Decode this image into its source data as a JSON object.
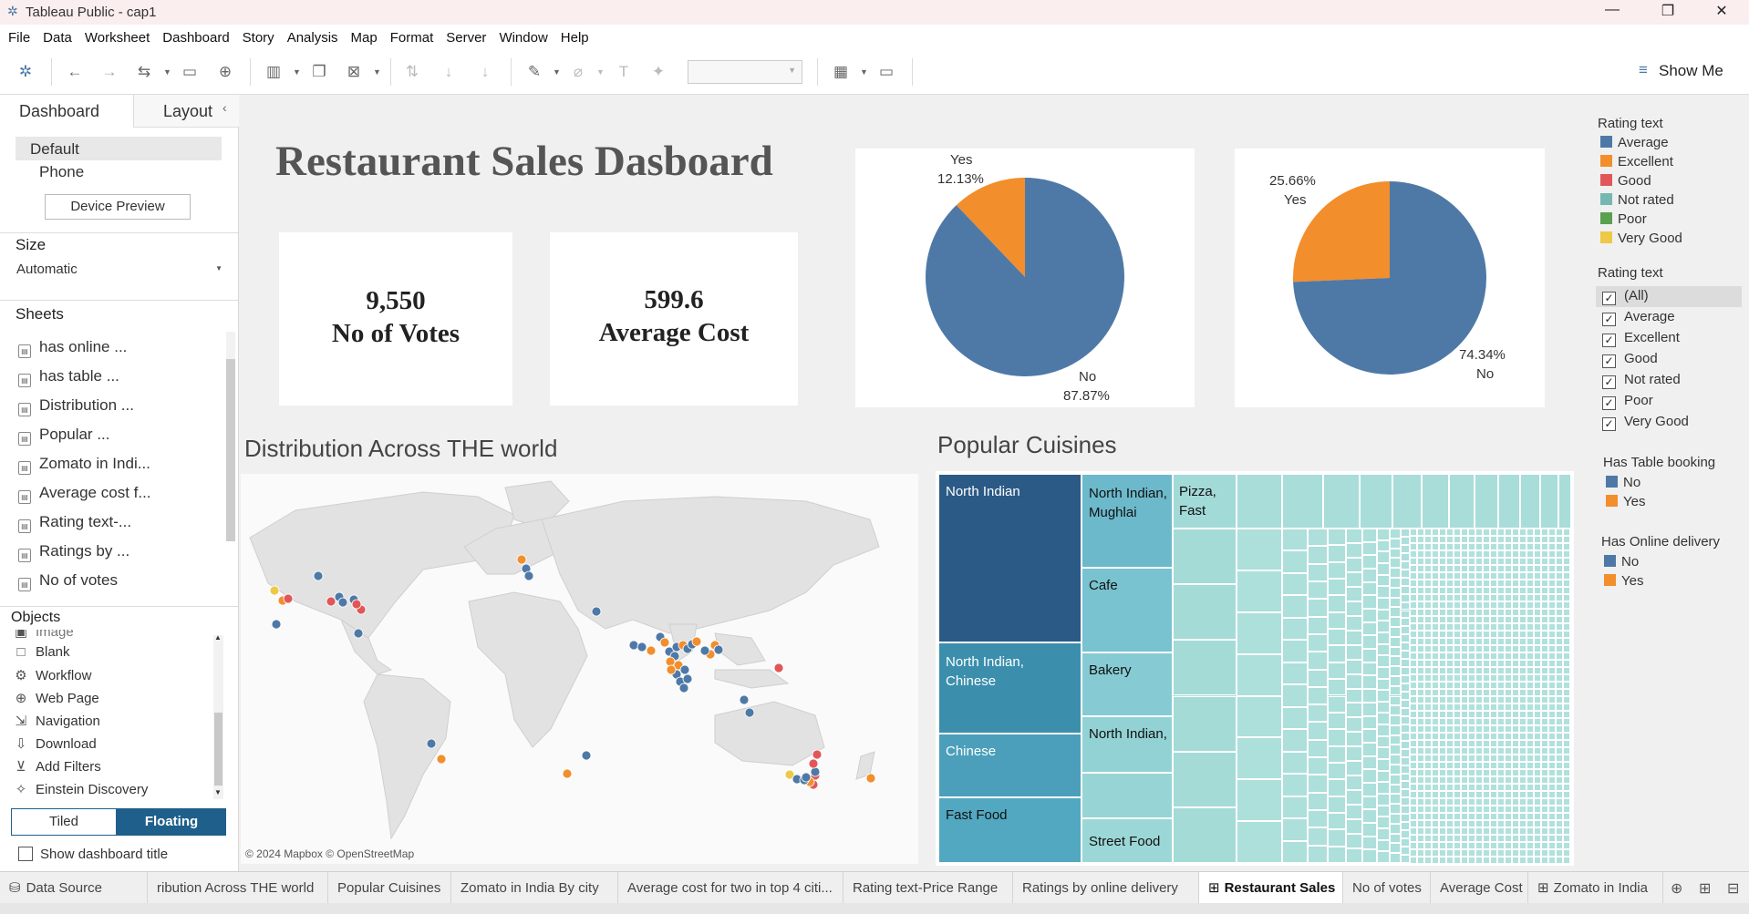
{
  "window": {
    "title": "Tableau Public - cap1",
    "minimize": "—",
    "restore": "❐",
    "close": "✕"
  },
  "menu": [
    "File",
    "Data",
    "Worksheet",
    "Dashboard",
    "Story",
    "Analysis",
    "Map",
    "Format",
    "Server",
    "Window",
    "Help"
  ],
  "toolbar": {
    "show_me": "Show Me"
  },
  "left_panel": {
    "tabs": {
      "dashboard": "Dashboard",
      "layout": "Layout"
    },
    "devices": {
      "default": "Default",
      "phone": "Phone",
      "preview": "Device Preview"
    },
    "size": {
      "title": "Size",
      "value": "Automatic"
    },
    "sheets_title": "Sheets",
    "sheets": [
      "has online ...",
      "has table ...",
      "Distribution ...",
      "Popular ...",
      "Zomato in Indi...",
      "Average cost f...",
      "Rating text-...",
      "Ratings by ...",
      "No of votes"
    ],
    "objects_title": "Objects",
    "objects": [
      "Image",
      "Blank",
      "Workflow",
      "Web Page",
      "Navigation",
      "Download",
      "Add Filters",
      "Einstein Discovery"
    ],
    "tiled": "Tiled",
    "floating": "Floating",
    "show_title": "Show dashboard title"
  },
  "dashboard": {
    "title": "Restaurant Sales Dasboard",
    "kpi_votes": {
      "value": "9,550",
      "label": "No of Votes"
    },
    "kpi_cost": {
      "value": "599.6",
      "label": "Average Cost"
    },
    "map_title": "Distribution Across THE world",
    "map_credit": "© 2024 Mapbox © OpenStreetMap",
    "treemap_title": "Popular Cuisines",
    "treemap_labels": [
      "North Indian",
      "North Indian, Chinese",
      "Chinese",
      "Fast Food",
      "North Indian, Mughlai",
      "Cafe",
      "Bakery",
      "North Indian,",
      "Street Food",
      "Pizza, Fast"
    ]
  },
  "chart_data": [
    {
      "type": "pie",
      "categories": [
        "Yes",
        "No"
      ],
      "values": [
        12.13,
        87.87
      ],
      "labels": [
        "12.13%",
        "87.87%"
      ],
      "colors": [
        "#f28e2b",
        "#4e79a7"
      ]
    },
    {
      "type": "pie",
      "categories": [
        "Yes",
        "No"
      ],
      "values": [
        25.66,
        74.34
      ],
      "labels": [
        "25.66%",
        "74.34%"
      ],
      "colors": [
        "#f28e2b",
        "#4e79a7"
      ]
    }
  ],
  "legends": {
    "rating_title": "Rating text",
    "rating_items": [
      {
        "label": "Average",
        "color": "#4e79a7"
      },
      {
        "label": "Excellent",
        "color": "#f28e2b"
      },
      {
        "label": "Good",
        "color": "#e15759"
      },
      {
        "label": "Not rated",
        "color": "#76b7b2"
      },
      {
        "label": "Poor",
        "color": "#59a14f"
      },
      {
        "label": "Very Good",
        "color": "#edc948"
      }
    ],
    "filter_title": "Rating text",
    "filter_items": [
      "(All)",
      "Average",
      "Excellent",
      "Good",
      "Not rated",
      "Poor",
      "Very Good"
    ],
    "table_title": "Has Table booking",
    "table_items": [
      {
        "label": "No",
        "color": "#4e79a7"
      },
      {
        "label": "Yes",
        "color": "#f28e2b"
      }
    ],
    "online_title": "Has Online delivery",
    "online_items": [
      {
        "label": "No",
        "color": "#4e79a7"
      },
      {
        "label": "Yes",
        "color": "#f28e2b"
      }
    ]
  },
  "bottom_tabs": [
    "Data Source",
    "ribution Across THE world",
    "Popular Cuisines",
    "Zomato in India By city",
    "Average cost for two in top 4 citi...",
    "Rating text-Price Range",
    "Ratings by online delivery",
    "Restaurant Sales",
    "No of votes",
    "Average Cost",
    "Zomato in India"
  ],
  "active_tab": "Restaurant Sales"
}
